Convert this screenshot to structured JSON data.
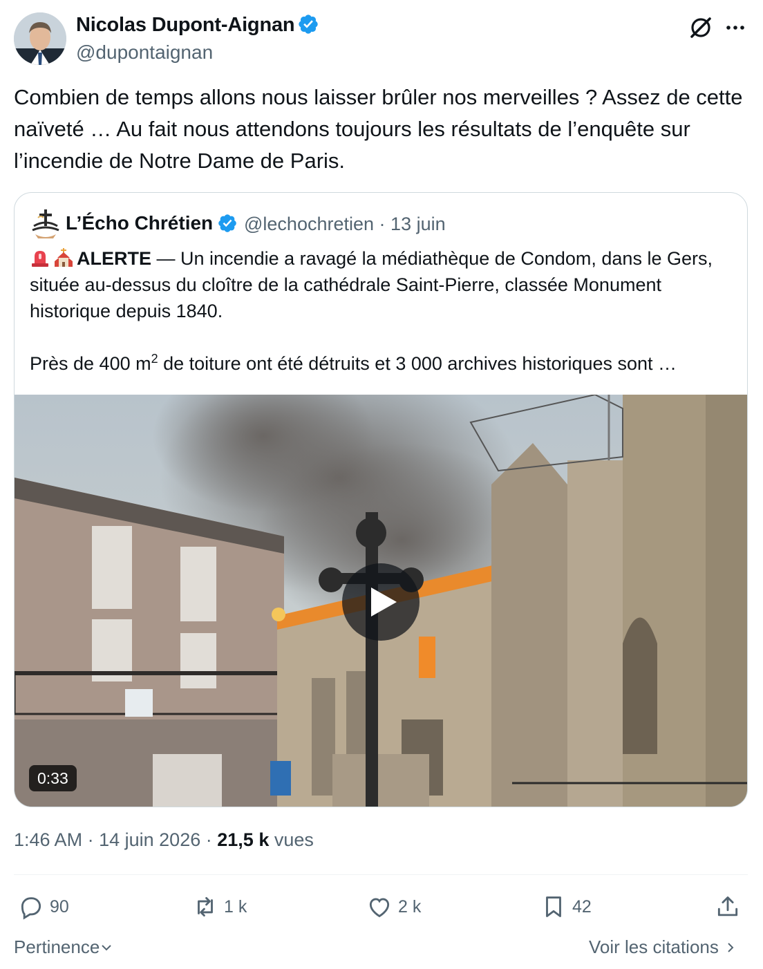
{
  "post": {
    "author_name": "Nicolas Dupont-Aignan",
    "author_handle": "@dupontaignan",
    "text": "Combien de temps allons nous laisser brûler nos merveilles ? Assez de cette naïveté  … Au fait nous attendons toujours les résultats de l’enquête sur l’incendie de Notre Dame de Paris.",
    "time": "1:46 AM",
    "date": "14 juin 2026",
    "separator": "·",
    "views_count": "21,5 k",
    "views_label": "vues"
  },
  "quote": {
    "author_name": "L’Écho Chrétien",
    "author_handle": "@lechochretien",
    "date": "13 juin",
    "separator": "·",
    "alert_label": "ALERTE",
    "text_part1": " — Un incendie a ravagé la médiathèque de Condom, dans le Gers, située au-dessus du cloître de la cathédrale Saint-Pierre, classée Monument historique depuis 1840.",
    "text_part2_prefix": "Près de 400 m",
    "text_part2_sup": "2",
    "text_part2_suffix": " de toiture ont été détruits et 3 000 archives historiques sont …",
    "video_duration": "0:33"
  },
  "actions": {
    "replies": "90",
    "reposts": "1 k",
    "likes": "2 k",
    "bookmarks": "42"
  },
  "footer": {
    "sort_label": "Pertinence",
    "quotes_link": "Voir les citations"
  },
  "icons": [
    "verified-badge-icon",
    "grok-icon",
    "more-icon",
    "play-icon",
    "reply-icon",
    "repost-icon",
    "like-icon",
    "bookmark-icon",
    "share-icon",
    "chevron-down-icon",
    "chevron-right-icon",
    "siren-emoji",
    "church-emoji"
  ],
  "colors": {
    "text": "#0f1419",
    "secondary": "#536471",
    "verified": "#1d9bf0",
    "border": "#cfd9de"
  }
}
